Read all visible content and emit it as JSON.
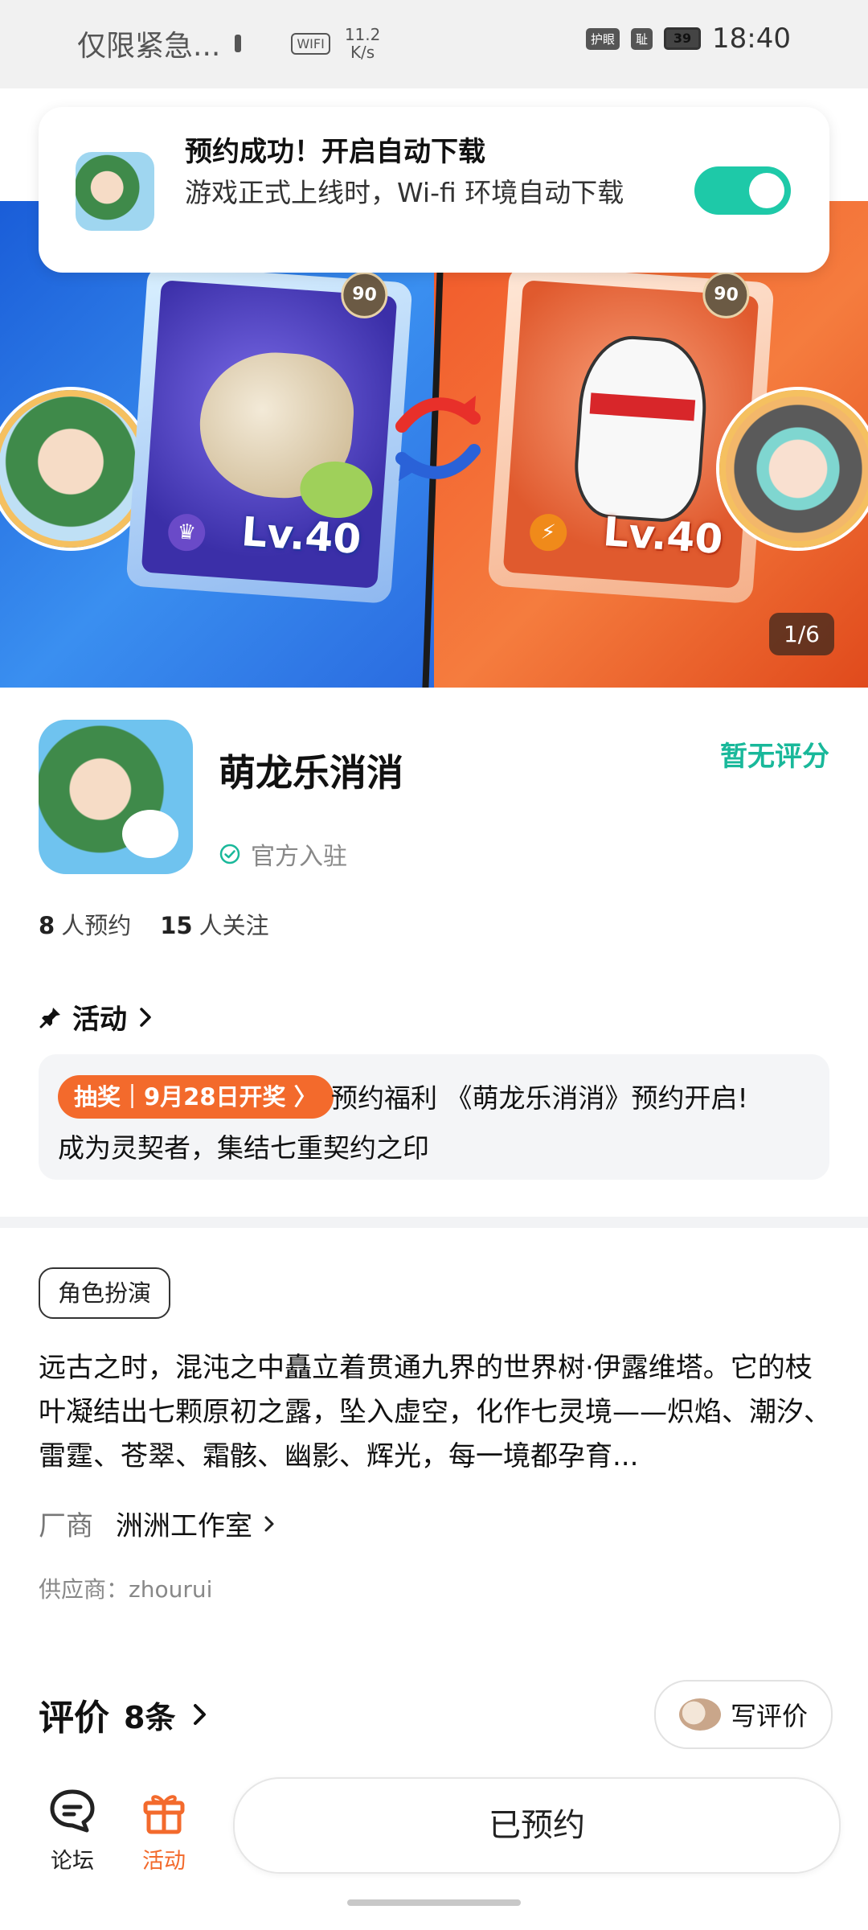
{
  "status_bar": {
    "notice": "仅限紧急...",
    "wifi": "WIFI",
    "speed_value": "11.2",
    "speed_unit": "K/s",
    "icon_eye": "护眼",
    "icon_sim": "耻",
    "battery": "39",
    "time": "18:40"
  },
  "toast": {
    "title": "预约成功！开启自动下载",
    "text": "游戏正式上线时，Wi-fi 环境自动下载",
    "toggle_on": true
  },
  "banner": {
    "card_left_level": "Lv.40",
    "card_right_level": "Lv.40",
    "card_left_badge": "90",
    "card_right_badge": "90",
    "page_indicator": "1/6"
  },
  "app": {
    "name": "萌龙乐消消",
    "rating": "暂无评分",
    "official": "官方入驻",
    "stats": [
      {
        "value": "8",
        "label": "人预约"
      },
      {
        "value": "15",
        "label": "人关注"
      }
    ]
  },
  "activity": {
    "title": "活动",
    "tag": "抽奖｜9月28日开奖 〉",
    "line1": "预约福利 《萌龙乐消消》预约开启!",
    "line2": "成为灵契者，集结七重契约之印"
  },
  "details": {
    "genre": "角色扮演",
    "description": "远古之时，混沌之中矗立着贯通九界的世界树·伊露维塔。它的枝叶凝结出七颗原初之露，坠入虚空，化作七灵境——炽焰、潮汐、雷霆、苍翠、霜骸、幽影、辉光，每一境都孕育...",
    "vendor_label": "厂商",
    "vendor_name": "洲洲工作室",
    "supplier": "供应商：zhourui"
  },
  "reviews": {
    "title": "评价",
    "count": "8条",
    "write_label": "写评价"
  },
  "bottom_bar": {
    "forum_label": "论坛",
    "activity_label": "活动",
    "reserved_label": "已预约"
  },
  "colors": {
    "accent_green": "#19b89a",
    "toggle_green": "#1ec9a8",
    "activity_orange": "#f36a2c"
  }
}
